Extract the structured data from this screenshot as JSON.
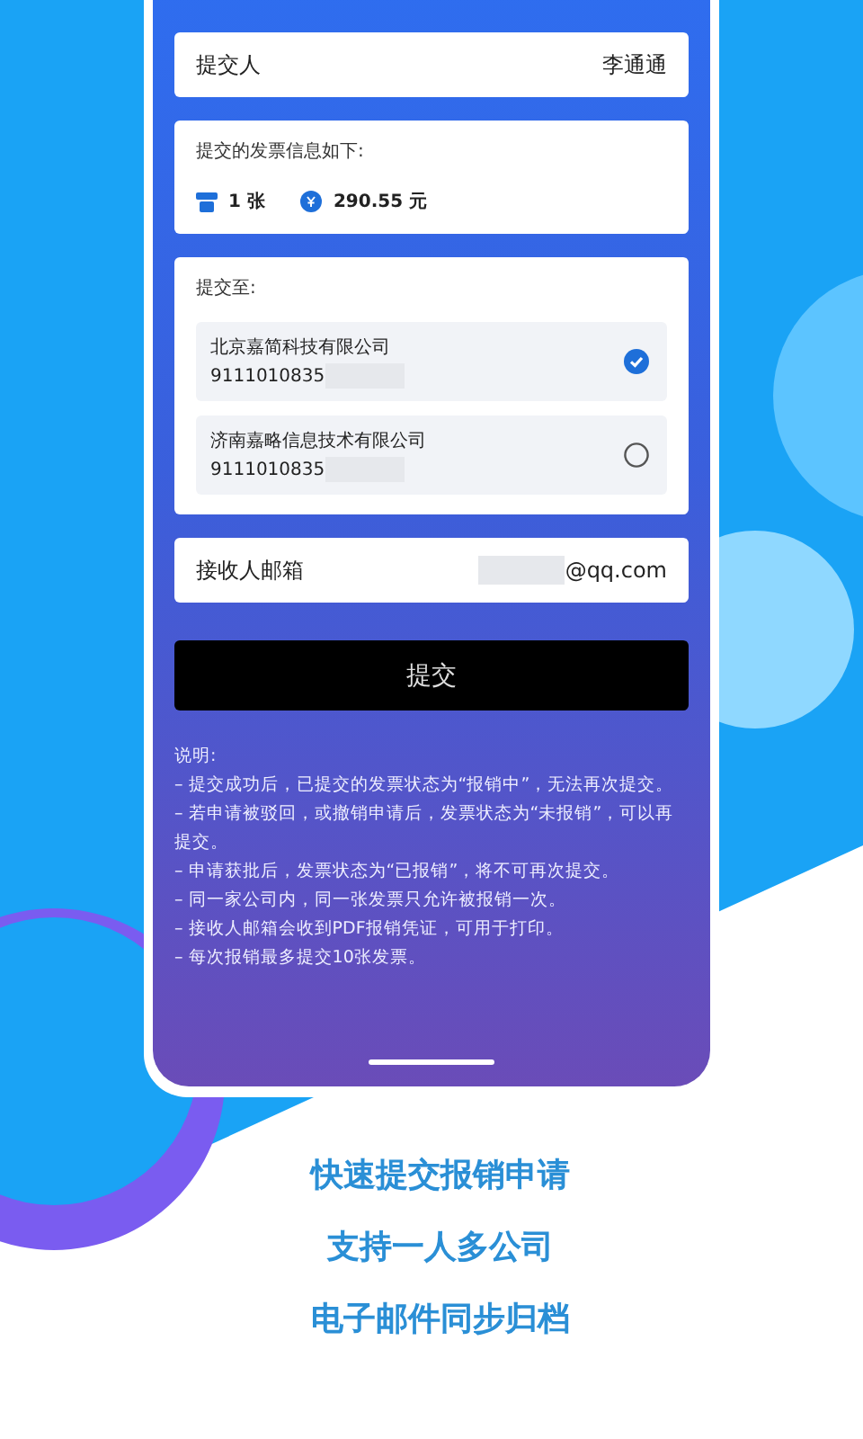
{
  "submitter": {
    "label": "提交人",
    "value": "李通通"
  },
  "invoice_info": {
    "title": "提交的发票信息如下:",
    "count": "1 张",
    "amount": "290.55 元"
  },
  "submit_to": {
    "title": "提交至:",
    "companies": [
      {
        "name": "北京嘉简科技有限公司",
        "tax_id": "9111010835",
        "selected": true
      },
      {
        "name": "济南嘉略信息技术有限公司",
        "tax_id": "9111010835",
        "selected": false
      }
    ]
  },
  "email": {
    "label": "接收人邮箱",
    "value": "@qq.com"
  },
  "submit_button": "提交",
  "notes": {
    "title": "说明:",
    "items": [
      "– 提交成功后，已提交的发票状态为“报销中”，无法再次提交。",
      "– 若申请被驳回，或撤销申请后，发票状态为“未报销”，可以再提交。",
      "– 申请获批后，发票状态为“已报销”，将不可再次提交。",
      "– 同一家公司内，同一张发票只允许被报销一次。",
      "– 接收人邮箱会收到PDF报销凭证，可用于打印。",
      "– 每次报销最多提交10张发票。"
    ]
  },
  "taglines": [
    "快速提交报销申请",
    "支持一人多公司",
    "电子邮件同步归档"
  ]
}
